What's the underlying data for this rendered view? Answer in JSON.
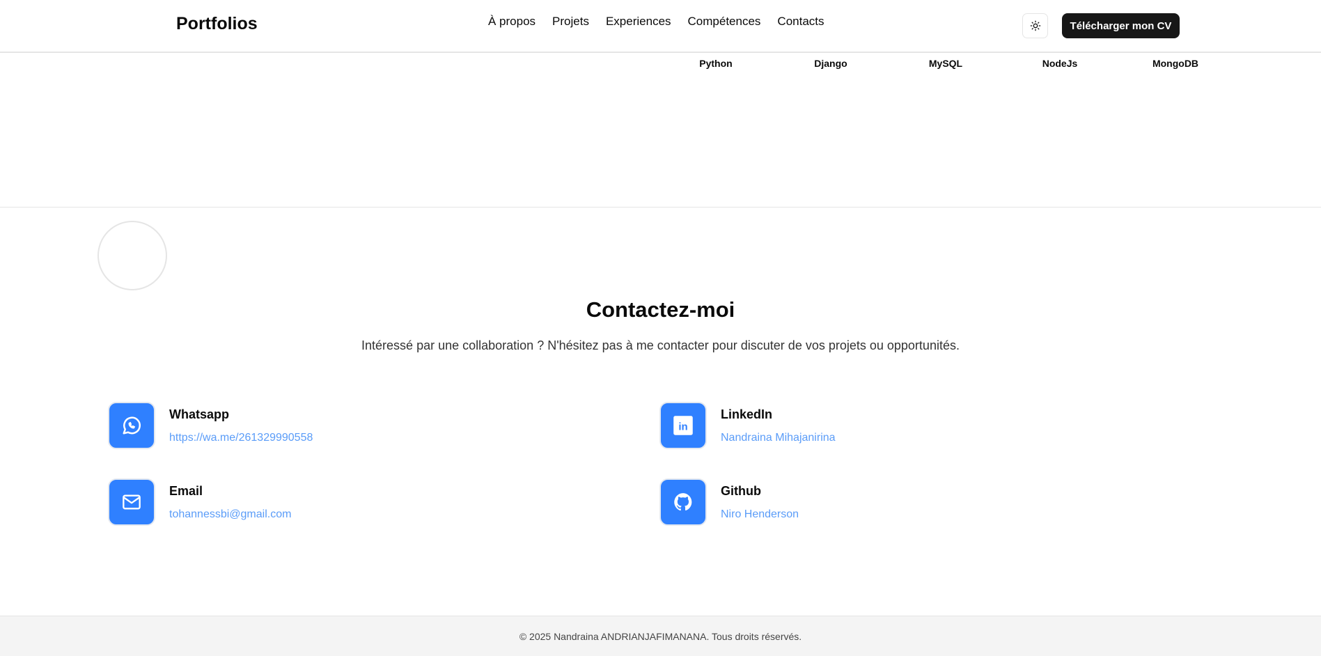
{
  "header": {
    "logo": "Portfolios",
    "nav": [
      "À propos",
      "Projets",
      "Experiences",
      "Compétences",
      "Contacts"
    ],
    "theme_icon": "sun-icon",
    "cv_button": "Télécharger mon CV"
  },
  "skills": [
    "Python",
    "Django",
    "MySQL",
    "NodeJs",
    "MongoDB"
  ],
  "contact": {
    "title": "Contactez-moi",
    "subtitle": "Intéressé par une collaboration ? N'hésitez pas à me contacter pour discuter de vos projets ou opportunités.",
    "items": [
      {
        "title": "Whatsapp",
        "value": "https://wa.me/261329990558",
        "icon": "whatsapp-icon"
      },
      {
        "title": "LinkedIn",
        "value": "Nandraina Mihajanirina",
        "icon": "linkedin-icon"
      },
      {
        "title": "Email",
        "value": "tohannessbi@gmail.com",
        "icon": "mail-icon"
      },
      {
        "title": "Github",
        "value": "Niro Henderson",
        "icon": "github-icon"
      }
    ]
  },
  "footer": {
    "text": "© 2025 Nandraina ANDRIANJAFIMANANA. Tous droits réservés."
  },
  "colors": {
    "accent": "#2f80ff",
    "link": "#5a9cf8",
    "button": "#171717"
  }
}
